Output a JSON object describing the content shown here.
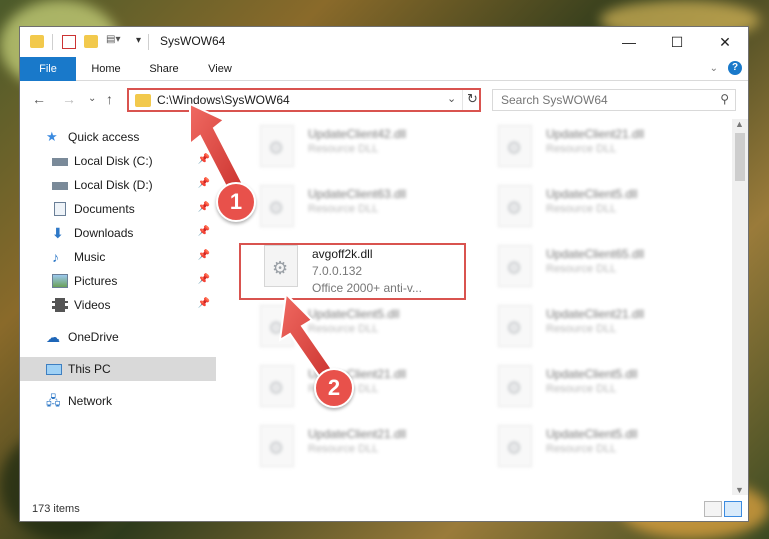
{
  "window": {
    "title": "SysWOW64",
    "controls": {
      "minimize": "—",
      "maximize": "☐",
      "close": "✕"
    }
  },
  "ribbon": {
    "tabs": [
      "File",
      "Home",
      "Share",
      "View"
    ]
  },
  "address": {
    "path": "C:\\Windows\\SysWOW64"
  },
  "search": {
    "placeholder": "Search SysWOW64"
  },
  "sidebar": {
    "quick_access": "Quick access",
    "items": [
      {
        "label": "Local Disk (C:)",
        "icon": "drive-icon"
      },
      {
        "label": "Local Disk (D:)",
        "icon": "drive-icon"
      },
      {
        "label": "Documents",
        "icon": "documents-icon"
      },
      {
        "label": "Downloads",
        "icon": "downloads-icon"
      },
      {
        "label": "Music",
        "icon": "music-icon"
      },
      {
        "label": "Pictures",
        "icon": "pictures-icon"
      },
      {
        "label": "Videos",
        "icon": "videos-icon"
      }
    ],
    "onedrive": "OneDrive",
    "this_pc": "This PC",
    "network": "Network"
  },
  "files": [
    {
      "name": "UpdateClient42.dll",
      "desc": "Resource DLL"
    },
    {
      "name": "UpdateClient21.dll",
      "desc": "Resource DLL"
    },
    {
      "name": "UpdateClient63.dll",
      "desc": "Resource DLL"
    },
    {
      "name": "UpdateClient5.dll",
      "desc": "Resource DLL"
    },
    {
      "name": "UpdateClient65.dll",
      "desc": "Resource DLL"
    },
    {
      "name": "UpdateClient5.dll",
      "desc": "Resource DLL"
    },
    {
      "name": "UpdateClient21.dll",
      "desc": "Resource DLL"
    },
    {
      "name": "UpdateClient21.dll",
      "desc": "Resource DLL"
    },
    {
      "name": "UpdateClient5.dll",
      "desc": "Resource DLL"
    },
    {
      "name": "UpdateClient21.dll",
      "desc": "Resource DLL"
    },
    {
      "name": "UpdateClient5.dll",
      "desc": "Resource DLL"
    },
    {
      "name": "UpdateClient65.dll",
      "desc": "Resource DLL"
    }
  ],
  "highlighted_file": {
    "name": "avgoff2k.dll",
    "version": "7.0.0.132",
    "desc": "Office 2000+ anti-v..."
  },
  "status": {
    "count": "173 items"
  },
  "callouts": [
    "1",
    "2"
  ],
  "colors": {
    "accent": "#1979ca",
    "highlight_border": "#d9534f",
    "callout": "#e8514b"
  }
}
